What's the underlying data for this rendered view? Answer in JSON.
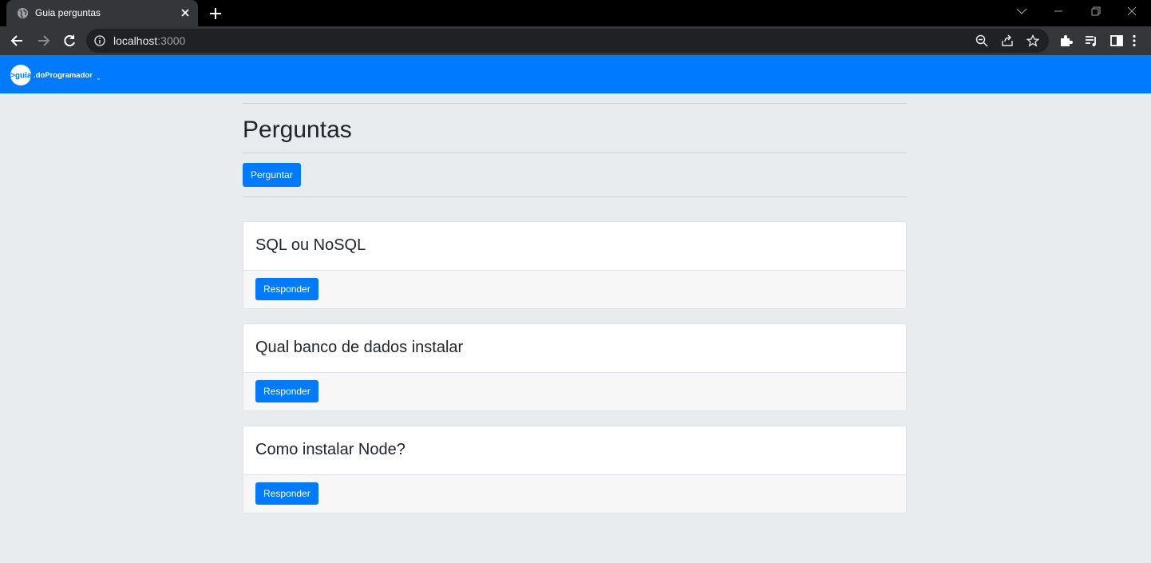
{
  "browser": {
    "tab_title": "Guia perguntas",
    "url_host": "localhost",
    "url_port": ":3000"
  },
  "navbar": {
    "logo_text": "guia.doProgramador"
  },
  "main": {
    "heading": "Perguntas",
    "ask_button": "Perguntar",
    "questions": [
      {
        "title": "SQL ou NoSQL",
        "reply_button": "Responder"
      },
      {
        "title": "Qual banco de dados instalar",
        "reply_button": "Responder"
      },
      {
        "title": "Como instalar Node?",
        "reply_button": "Responder"
      }
    ]
  },
  "colors": {
    "primary": "#007bff",
    "page_bg": "#e9ecef",
    "chrome_dark": "#35363a"
  }
}
